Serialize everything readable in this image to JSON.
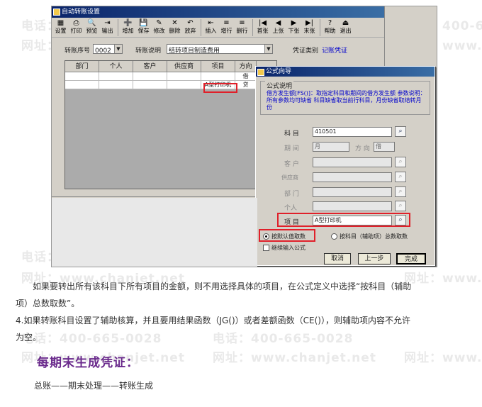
{
  "watermark": {
    "phone": "电话：400-665-0028",
    "site": "网址：www.chanjet.net"
  },
  "main_window": {
    "title": "自动转账设置",
    "toolbar": [
      "设置",
      "打印",
      "预览",
      "输出",
      "增加",
      "保存",
      "修改",
      "删除",
      "放弃",
      "插入",
      "增行",
      "删行",
      "首张",
      "上张",
      "下张",
      "末张",
      "帮助",
      "退出"
    ],
    "toolbar_icons": [
      "settings-icon",
      "print-icon",
      "preview-icon",
      "export-icon",
      "add-icon",
      "save-icon",
      "edit-icon",
      "delete-icon",
      "undo-icon",
      "insert-icon",
      "add-row-icon",
      "delete-row-icon",
      "first-icon",
      "prev-icon",
      "next-icon",
      "last-icon",
      "help-icon",
      "exit-icon"
    ],
    "seq_label": "转账序号",
    "seq_value": "0002",
    "desc_label": "转账说明",
    "desc_value": "结转项目制造费用",
    "voucher_label": "凭证类别",
    "voucher_value": "记账凭证",
    "grid_headers": [
      "部门",
      "个人",
      "客户",
      "供应商",
      "项目",
      "方向"
    ],
    "grid_rows": [
      [
        "",
        "",
        "",
        "",
        "",
        "借"
      ],
      [
        "",
        "",
        "",
        "",
        "A型打印机",
        "贷"
      ]
    ]
  },
  "dialog": {
    "title": "公式向导",
    "desc_legend": "公式说明",
    "desc_text": "借方发生额[FS()]：取指定科目和期间的借方发生额  参数说明：所有参数均可缺省  科目缺省取当前行科目，月份缺省取结转月份",
    "subject_label": "科 目",
    "subject_value": "410501",
    "period_label": "期 间",
    "period_value": "月",
    "direction_label": "方 向",
    "direction_value": "借",
    "customer_label": "客 户",
    "supplier_label": "供应商",
    "dept_label": "部 门",
    "person_label": "个人",
    "project_label": "项 目",
    "project_value": "A型打印机",
    "radio_default": "按默认值取数",
    "radio_aux": "按科目（辅助项）总数取数",
    "checkbox_continue": "继续输入公式",
    "btn_cancel": "取消",
    "btn_prev": "上一步",
    "btn_finish": "完成"
  },
  "article": {
    "para1_line1": "如果要转出所有该科目下所有项目的金额，则不用选择具体的项目，在公式定义中选择“按科目（辅助",
    "para1_line2": "项）总数取数”。",
    "para2_line1": "4.如果转账科目设置了辅助核算，并且要用结果函数（JG()）或者差额函数（CE()），则辅助项内容不允许",
    "para2_line2": "为空。",
    "heading": "每期末生成凭证：",
    "path": "总账——期末处理——转账生成"
  },
  "colors": {
    "title_bar": "#0a246a",
    "highlight_red": "#e0202a",
    "heading_purple": "#6a2a8c",
    "desc_blue": "#0000cc"
  }
}
